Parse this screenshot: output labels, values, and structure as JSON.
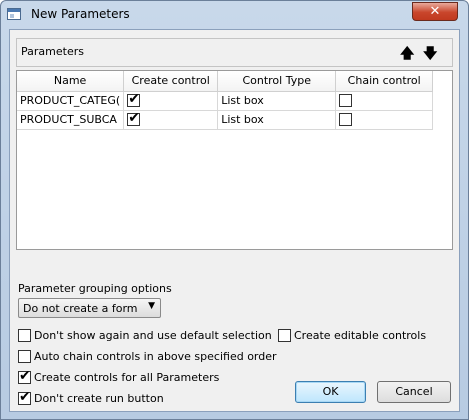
{
  "window": {
    "title": "New Parameters",
    "close_symbol": "✕"
  },
  "parameters": {
    "label": "Parameters",
    "move_up_symbol": "🡅",
    "move_down_symbol": "🡇",
    "columns": [
      "Name",
      "Create control",
      "Control Type",
      "Chain control"
    ],
    "rows": [
      {
        "name": "PRODUCT_CATEG(",
        "create_control": true,
        "control_type": "List box",
        "chain_control": false
      },
      {
        "name": "PRODUCT_SUBCA",
        "create_control": true,
        "control_type": "List box",
        "chain_control": false
      }
    ]
  },
  "grouping": {
    "label": "Parameter grouping options",
    "selected": "Do not create a form",
    "arrow": "▼"
  },
  "options": {
    "dont_show_again": {
      "label": "Don't show again and use default selection",
      "checked": false
    },
    "create_editable": {
      "label": "Create editable controls",
      "checked": false
    },
    "auto_chain": {
      "label": "Auto chain controls in above specified order",
      "checked": false
    },
    "create_all": {
      "label": "Create controls for all Parameters",
      "checked": true
    },
    "dont_create_run": {
      "label": "Don't create run button",
      "checked": true
    }
  },
  "buttons": {
    "ok": "OK",
    "cancel": "Cancel"
  }
}
